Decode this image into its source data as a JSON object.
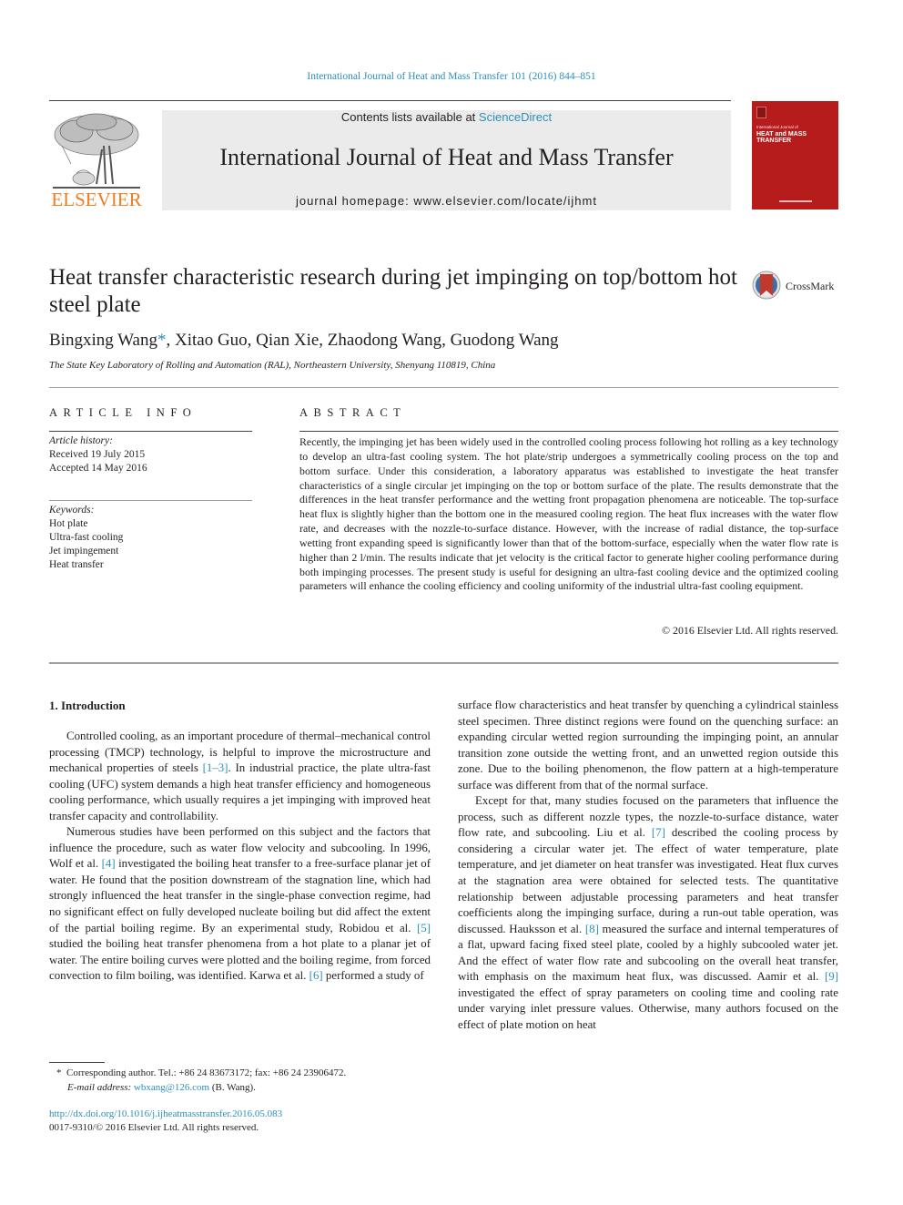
{
  "header": {
    "journal_reference": "International Journal of Heat and Mass Transfer 101 (2016) 844–851",
    "contents_prefix": "Contents lists available at ",
    "contents_link": "ScienceDirect",
    "journal_title": "International Journal of Heat and Mass Transfer",
    "homepage_prefix": "journal homepage: ",
    "homepage_url": "www.elsevier.com/locate/ijhmt",
    "publisher_logo_text": "ELSEVIER",
    "cover": {
      "kicker": "International Journal of",
      "title_line1": "HEAT and MASS",
      "title_line2": "TRANSFER",
      "color": "#b71c1c"
    }
  },
  "article": {
    "title": "Heat transfer characteristic research during jet impinging on top/bottom hot steel plate",
    "crossmark_label": "CrossMark",
    "authors": [
      {
        "name": "Bingxing Wang",
        "corresponding": true
      },
      {
        "name": "Xitao Guo",
        "corresponding": false
      },
      {
        "name": "Qian Xie",
        "corresponding": false
      },
      {
        "name": "Zhaodong Wang",
        "corresponding": false
      },
      {
        "name": "Guodong Wang",
        "corresponding": false
      }
    ],
    "authors_display": {
      "first": "Bingxing Wang",
      "star": "*",
      "rest": ", Xitao Guo, Qian Xie, Zhaodong Wang, Guodong Wang"
    },
    "affiliation": "The State Key Laboratory of Rolling and Automation (RAL), Northeastern University, Shenyang 110819, China"
  },
  "article_info": {
    "heading": "ARTICLE INFO",
    "history_label": "Article history:",
    "received": "Received 19 July 2015",
    "accepted": "Accepted 14 May 2016",
    "keywords_label": "Keywords:",
    "keywords": [
      "Hot plate",
      "Ultra-fast cooling",
      "Jet impingement",
      "Heat transfer"
    ]
  },
  "abstract": {
    "heading": "ABSTRACT",
    "text": "Recently, the impinging jet has been widely used in the controlled cooling process following hot rolling as a key technology to develop an ultra-fast cooling system. The hot plate/strip undergoes a symmetrically cooling process on the top and bottom surface. Under this consideration, a laboratory apparatus was established to investigate the heat transfer characteristics of a single circular jet impinging on the top or bottom surface of the plate. The results demonstrate that the differences in the heat transfer performance and the wetting front propagation phenomena are noticeable. The top-surface heat flux is slightly higher than the bottom one in the measured cooling region. The heat flux increases with the water flow rate, and decreases with the nozzle-to-surface distance. However, with the increase of radial distance, the top-surface wetting front expanding speed is significantly lower than that of the bottom-surface, especially when the water flow rate is higher than 2 l/min. The results indicate that jet velocity is the critical factor to generate higher cooling performance during both impinging processes. The present study is useful for designing an ultra-fast cooling device and the optimized cooling parameters will enhance the cooling efficiency and cooling uniformity of the industrial ultra-fast cooling equipment.",
    "copyright": "© 2016 Elsevier Ltd. All rights reserved."
  },
  "body": {
    "section_heading": "1. Introduction",
    "left": {
      "p1_a": "Controlled cooling, as an important procedure of thermal–mechanical control processing (TMCP) technology, is helpful to improve the microstructure and mechanical properties of steels ",
      "p1_ref": "[1–3]",
      "p1_b": ". In industrial practice, the plate ultra-fast cooling (UFC) system demands a high heat transfer efficiency and homogeneous cooling performance, which usually requires a jet impinging with improved heat transfer capacity and controllability.",
      "p2_a": "Numerous studies have been performed on this subject and the factors that influence the procedure, such as water flow velocity and subcooling. In 1996, Wolf et al. ",
      "p2_ref1": "[4]",
      "p2_b": " investigated the boiling heat transfer to a free-surface planar jet of water. He found that the position downstream of the stagnation line, which had strongly influenced the heat transfer in the single-phase convection regime, had no significant effect on fully developed nucleate boiling but did affect the extent of the partial boiling regime. By an experimental study, Robidou et al. ",
      "p2_ref2": "[5]",
      "p2_c": " studied the boiling heat transfer phenomena from a hot plate to a planar jet of water. The entire boiling curves were plotted and the boiling regime, from forced convection to film boiling, was identified. Karwa et al. ",
      "p2_ref3": "[6]",
      "p2_d": " performed a study of"
    },
    "right": {
      "p1": "surface flow characteristics and heat transfer by quenching a cylindrical stainless steel specimen. Three distinct regions were found on the quenching surface: an expanding circular wetted region surrounding the impinging point, an annular transition zone outside the wetting front, and an unwetted region outside this zone. Due to the boiling phenomenon, the flow pattern at a high-temperature surface was different from that of the normal surface.",
      "p2_a": "Except for that, many studies focused on the parameters that influence the process, such as different nozzle types, the nozzle-to-surface distance, water flow rate, and subcooling. Liu et al. ",
      "p2_ref1": "[7]",
      "p2_b": " described the cooling process by considering a circular water jet. The effect of water temperature, plate temperature, and jet diameter on heat transfer was investigated. Heat flux curves at the stagnation area were obtained for selected tests. The quantitative relationship between adjustable processing parameters and heat transfer coefficients along the impinging surface, during a run-out table operation, was discussed. Hauksson et al. ",
      "p2_ref2": "[8]",
      "p2_c": " measured the surface and internal temperatures of a flat, upward facing fixed steel plate, cooled by a highly subcooled water jet. And the effect of water flow rate and subcooling on the overall heat transfer, with emphasis on the maximum heat flux, was discussed. Aamir et al. ",
      "p2_ref3": "[9]",
      "p2_d": " investigated the effect of spray parameters on cooling time and cooling rate under varying inlet pressure values. Otherwise, many authors focused on the effect of plate motion on heat"
    }
  },
  "footnotes": {
    "star": "*",
    "corresponding": "Corresponding author. Tel.: +86 24 83673172; fax: +86 24 23906472.",
    "email_label": "E-mail address: ",
    "email": "wbxang@126.com",
    "email_suffix": " (B. Wang).",
    "doi_url": "http://dx.doi.org/10.1016/j.ijheatmasstransfer.2016.05.083",
    "issn_copyright": "0017-9310/© 2016 Elsevier Ltd. All rights reserved."
  }
}
